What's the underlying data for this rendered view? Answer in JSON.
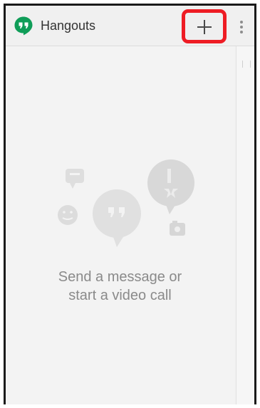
{
  "app": {
    "title": "Hangouts",
    "logo_icon": "hangouts-logo-icon",
    "brand_color": "#0f9d58"
  },
  "toolbar": {
    "new_icon": "plus-icon",
    "overflow_icon": "vertical-ellipsis-icon",
    "highlight_color": "#ee1c24"
  },
  "empty_state": {
    "line1": "Send a message or",
    "line2": "start a video call",
    "illustration_icon": "chat-bubbles-illustration"
  }
}
